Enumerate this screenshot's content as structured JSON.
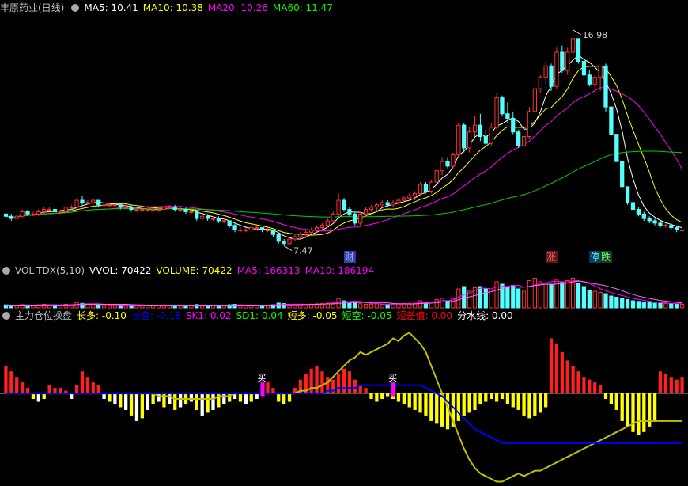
{
  "price_panel": {
    "title": "丰原药业(日线)",
    "ma_labels": [
      {
        "text": "MA5: 10.41",
        "color": "#ffffff"
      },
      {
        "text": "MA10: 10.38",
        "color": "#ffff00"
      },
      {
        "text": "MA20: 10.26",
        "color": "#ff00ff"
      },
      {
        "text": "MA60: 11.47",
        "color": "#00ff00"
      }
    ],
    "high_label": "16.98",
    "low_label": "7.47",
    "markers": [
      "财",
      "涨",
      "停",
      "跌"
    ]
  },
  "volume_panel": {
    "labels": [
      {
        "text": "VOL-TDX(5,10)",
        "color": "#c0c0c0"
      },
      {
        "text": "VVOL: 70422",
        "color": "#ffffff"
      },
      {
        "text": "VOLUME: 70422",
        "color": "#ffff00"
      },
      {
        "text": "MA5: 166313",
        "color": "#ff00ff"
      },
      {
        "text": "MA10: 186194",
        "color": "#ff00ff"
      }
    ]
  },
  "indicator_panel": {
    "labels": [
      {
        "text": "主力仓位操盘",
        "color": "#c0c0c0"
      },
      {
        "text": "长多: -0.10",
        "color": "#ffff00"
      },
      {
        "text": "长空: -0.18",
        "color": "#0000ff"
      },
      {
        "text": "SK1: 0.02",
        "color": "#ff00ff"
      },
      {
        "text": "SD1: 0.04",
        "color": "#00ff00"
      },
      {
        "text": "短多: -0.05",
        "color": "#ffff00"
      },
      {
        "text": "短空: -0.05",
        "color": "#00ff00"
      },
      {
        "text": "短差值: 0.00",
        "color": "#ff0000"
      },
      {
        "text": "分水线: 0.00",
        "color": "#ffffff"
      }
    ],
    "buy_label": "买"
  },
  "chart_data": {
    "type": "candlestick",
    "price_range": [
      7.0,
      17.6
    ],
    "candles": [
      [
        8.9,
        9.0,
        8.7,
        8.8
      ],
      [
        8.8,
        8.9,
        8.6,
        8.7
      ],
      [
        8.7,
        8.9,
        8.7,
        8.8
      ],
      [
        8.8,
        9.1,
        8.7,
        9.0
      ],
      [
        9.0,
        9.1,
        8.8,
        8.9
      ],
      [
        8.9,
        9.0,
        8.8,
        8.9
      ],
      [
        8.9,
        9.1,
        8.8,
        9.0
      ],
      [
        9.0,
        9.2,
        8.9,
        9.1
      ],
      [
        9.1,
        9.2,
        9.0,
        9.1
      ],
      [
        9.1,
        9.2,
        8.9,
        9.0
      ],
      [
        9.0,
        9.1,
        8.9,
        9.0
      ],
      [
        9.0,
        9.3,
        9.0,
        9.2
      ],
      [
        9.2,
        9.3,
        9.1,
        9.2
      ],
      [
        9.2,
        9.6,
        9.1,
        9.5
      ],
      [
        9.5,
        9.7,
        9.3,
        9.4
      ],
      [
        9.4,
        9.5,
        9.3,
        9.4
      ],
      [
        9.4,
        9.6,
        9.3,
        9.5
      ],
      [
        9.5,
        9.5,
        9.2,
        9.3
      ],
      [
        9.3,
        9.4,
        9.2,
        9.3
      ],
      [
        9.3,
        9.4,
        9.2,
        9.3
      ],
      [
        9.3,
        9.4,
        9.2,
        9.3
      ],
      [
        9.3,
        9.4,
        9.1,
        9.2
      ],
      [
        9.2,
        9.3,
        9.1,
        9.2
      ],
      [
        9.2,
        9.3,
        9.0,
        9.1
      ],
      [
        9.1,
        9.2,
        9.0,
        9.1
      ],
      [
        9.1,
        9.2,
        9.0,
        9.1
      ],
      [
        9.1,
        9.2,
        9.0,
        9.1
      ],
      [
        9.1,
        9.2,
        9.0,
        9.1
      ],
      [
        9.1,
        9.2,
        9.0,
        9.1
      ],
      [
        9.1,
        9.3,
        9.0,
        9.2
      ],
      [
        9.2,
        9.3,
        9.1,
        9.2
      ],
      [
        9.2,
        9.3,
        9.0,
        9.1
      ],
      [
        9.1,
        9.2,
        9.0,
        9.1
      ],
      [
        9.1,
        9.2,
        8.9,
        9.0
      ],
      [
        9.0,
        9.1,
        8.9,
        9.0
      ],
      [
        9.0,
        9.0,
        8.6,
        8.7
      ],
      [
        8.7,
        8.9,
        8.6,
        8.8
      ],
      [
        8.8,
        8.9,
        8.6,
        8.7
      ],
      [
        8.7,
        8.8,
        8.6,
        8.7
      ],
      [
        8.7,
        8.8,
        8.5,
        8.6
      ],
      [
        8.6,
        8.7,
        8.5,
        8.6
      ],
      [
        8.6,
        8.6,
        8.3,
        8.4
      ],
      [
        8.4,
        8.5,
        8.1,
        8.2
      ],
      [
        8.2,
        8.3,
        8.1,
        8.2
      ],
      [
        8.2,
        8.3,
        8.1,
        8.2
      ],
      [
        8.2,
        8.4,
        8.1,
        8.3
      ],
      [
        8.3,
        8.4,
        8.2,
        8.3
      ],
      [
        8.3,
        8.3,
        8.1,
        8.2
      ],
      [
        8.2,
        8.3,
        8.1,
        8.2
      ],
      [
        8.2,
        8.2,
        7.9,
        8.0
      ],
      [
        8.0,
        8.1,
        7.6,
        7.7
      ],
      [
        7.7,
        7.8,
        7.5,
        7.6
      ],
      [
        7.6,
        7.9,
        7.5,
        7.8
      ],
      [
        7.8,
        8.0,
        7.7,
        7.9
      ],
      [
        7.9,
        8.1,
        7.8,
        8.0
      ],
      [
        8.0,
        8.2,
        7.9,
        8.1
      ],
      [
        8.1,
        8.3,
        8.0,
        8.2
      ],
      [
        8.2,
        8.4,
        8.1,
        8.3
      ],
      [
        8.3,
        8.5,
        8.2,
        8.4
      ],
      [
        8.4,
        8.7,
        8.3,
        8.6
      ],
      [
        8.6,
        9.0,
        8.5,
        8.9
      ],
      [
        8.9,
        9.8,
        8.8,
        9.5
      ],
      [
        9.5,
        9.6,
        9.0,
        9.1
      ],
      [
        9.1,
        9.2,
        8.8,
        8.9
      ],
      [
        8.9,
        9.0,
        8.4,
        8.5
      ],
      [
        8.5,
        9.0,
        8.4,
        8.9
      ],
      [
        8.9,
        9.2,
        8.8,
        9.1
      ],
      [
        9.1,
        9.3,
        9.0,
        9.2
      ],
      [
        9.2,
        9.4,
        9.0,
        9.3
      ],
      [
        9.3,
        9.5,
        9.2,
        9.4
      ],
      [
        9.4,
        9.5,
        9.2,
        9.3
      ],
      [
        9.3,
        9.5,
        9.2,
        9.4
      ],
      [
        9.4,
        9.6,
        9.3,
        9.5
      ],
      [
        9.5,
        9.7,
        9.4,
        9.6
      ],
      [
        9.6,
        9.8,
        9.5,
        9.7
      ],
      [
        9.7,
        9.9,
        9.5,
        9.8
      ],
      [
        9.8,
        10.3,
        9.7,
        10.2
      ],
      [
        10.2,
        10.3,
        9.8,
        9.9
      ],
      [
        9.9,
        10.4,
        9.8,
        10.3
      ],
      [
        10.3,
        10.9,
        10.2,
        10.8
      ],
      [
        10.8,
        11.4,
        10.6,
        11.2
      ],
      [
        11.2,
        11.4,
        10.9,
        11.0
      ],
      [
        11.0,
        11.6,
        10.9,
        11.5
      ],
      [
        11.5,
        12.9,
        11.4,
        12.8
      ],
      [
        12.8,
        12.9,
        11.6,
        11.8
      ],
      [
        11.8,
        12.7,
        11.6,
        12.5
      ],
      [
        12.5,
        13.2,
        12.3,
        12.8
      ],
      [
        12.8,
        13.3,
        12.1,
        12.3
      ],
      [
        12.3,
        12.6,
        11.8,
        12.0
      ],
      [
        12.0,
        12.9,
        11.9,
        12.7
      ],
      [
        12.7,
        14.2,
        12.6,
        14.0
      ],
      [
        14.0,
        14.1,
        13.2,
        13.3
      ],
      [
        13.3,
        13.8,
        12.9,
        13.1
      ],
      [
        13.1,
        13.4,
        12.4,
        12.5
      ],
      [
        12.5,
        12.6,
        11.8,
        11.9
      ],
      [
        11.9,
        12.4,
        11.8,
        12.3
      ],
      [
        12.3,
        13.6,
        12.2,
        13.4
      ],
      [
        13.4,
        14.5,
        13.3,
        14.4
      ],
      [
        14.4,
        15.0,
        14.2,
        14.9
      ],
      [
        14.9,
        15.6,
        14.6,
        15.4
      ],
      [
        15.4,
        15.5,
        14.3,
        14.5
      ],
      [
        14.5,
        16.2,
        14.4,
        16.0
      ],
      [
        16.0,
        16.3,
        15.1,
        15.2
      ],
      [
        15.2,
        16.2,
        15.0,
        16.0
      ],
      [
        16.0,
        16.98,
        15.8,
        16.6
      ],
      [
        16.6,
        16.6,
        15.5,
        15.6
      ],
      [
        15.6,
        15.8,
        14.8,
        15.0
      ],
      [
        15.0,
        15.2,
        14.5,
        14.6
      ],
      [
        14.6,
        15.0,
        14.2,
        14.9
      ],
      [
        14.9,
        15.4,
        14.3,
        15.4
      ],
      [
        15.4,
        15.5,
        13.4,
        13.6
      ],
      [
        13.6,
        13.6,
        12.4,
        12.4
      ],
      [
        12.4,
        12.4,
        11.2,
        11.2
      ],
      [
        11.2,
        11.2,
        10.1,
        10.1
      ],
      [
        10.1,
        10.1,
        9.3,
        9.4
      ],
      [
        9.4,
        9.5,
        9.0,
        9.1
      ],
      [
        9.1,
        9.2,
        8.8,
        8.9
      ],
      [
        8.9,
        9.0,
        8.6,
        8.7
      ],
      [
        8.7,
        8.8,
        8.5,
        8.6
      ],
      [
        8.6,
        8.7,
        8.4,
        8.5
      ],
      [
        8.5,
        8.6,
        8.3,
        8.4
      ],
      [
        8.4,
        8.5,
        8.3,
        8.4
      ],
      [
        8.4,
        8.5,
        8.2,
        8.3
      ],
      [
        8.3,
        8.4,
        8.1,
        8.2
      ],
      [
        8.2,
        8.3,
        8.1,
        8.2
      ]
    ],
    "volumes": [
      25,
      22,
      20,
      28,
      24,
      22,
      26,
      30,
      25,
      24,
      22,
      30,
      26,
      45,
      38,
      30,
      34,
      28,
      26,
      24,
      25,
      24,
      22,
      24,
      22,
      20,
      22,
      21,
      22,
      24,
      22,
      24,
      22,
      21,
      22,
      28,
      24,
      22,
      20,
      21,
      22,
      26,
      30,
      24,
      20,
      22,
      20,
      22,
      20,
      26,
      40,
      36,
      30,
      26,
      28,
      30,
      32,
      34,
      36,
      40,
      45,
      80,
      60,
      40,
      55,
      35,
      30,
      32,
      34,
      30,
      28,
      32,
      34,
      36,
      38,
      40,
      60,
      50,
      48,
      70,
      80,
      60,
      80,
      160,
      180,
      140,
      170,
      180,
      160,
      150,
      220,
      200,
      180,
      190,
      160,
      140,
      230,
      250,
      220,
      210,
      200,
      240,
      220,
      230,
      250,
      210,
      180,
      150,
      140,
      130,
      120,
      100,
      90,
      80,
      70,
      60,
      55,
      50,
      45,
      40,
      38,
      36,
      34,
      32,
      30
    ],
    "volume_max": 260,
    "indicator_range": [
      -0.33,
      0.25
    ],
    "indicator_bars": [
      0.1,
      0.08,
      0.06,
      0.04,
      0.02,
      -0.02,
      -0.03,
      -0.02,
      0.03,
      0.02,
      0.02,
      0.01,
      -0.02,
      0.03,
      0.08,
      0.06,
      0.04,
      0.03,
      -0.02,
      -0.03,
      -0.04,
      -0.05,
      -0.06,
      -0.08,
      -0.1,
      -0.09,
      -0.06,
      -0.04,
      -0.03,
      -0.05,
      -0.04,
      -0.06,
      -0.05,
      -0.04,
      -0.03,
      -0.06,
      -0.08,
      -0.07,
      -0.06,
      -0.05,
      -0.04,
      -0.03,
      -0.02,
      -0.03,
      -0.04,
      -0.03,
      -0.02,
      0.03,
      0.04,
      0.02,
      -0.03,
      -0.04,
      -0.03,
      0.02,
      0.05,
      0.07,
      0.09,
      0.1,
      0.08,
      0.06,
      0.05,
      0.07,
      0.09,
      0.08,
      0.05,
      0.03,
      0.02,
      -0.02,
      -0.03,
      -0.02,
      -0.01,
      -0.02,
      -0.03,
      -0.04,
      -0.05,
      -0.06,
      -0.07,
      -0.08,
      -0.1,
      -0.11,
      -0.12,
      -0.13,
      -0.12,
      -0.1,
      -0.08,
      -0.07,
      -0.06,
      -0.04,
      -0.03,
      -0.02,
      -0.03,
      -0.02,
      -0.04,
      -0.05,
      -0.06,
      -0.08,
      -0.09,
      -0.08,
      -0.07,
      -0.05,
      0.2,
      0.18,
      0.15,
      0.12,
      0.1,
      0.08,
      0.06,
      0.05,
      0.04,
      0.03,
      -0.02,
      -0.04,
      -0.06,
      -0.1,
      -0.12,
      -0.14,
      -0.15,
      -0.14,
      -0.12,
      -0.1,
      0.08,
      0.07,
      0.06,
      0.05,
      0.06
    ],
    "indicator_lines": [
      {
        "name": "长多",
        "color": "#c0c000",
        "values": [
          0.0,
          0.0,
          0.0,
          0.0,
          0.0,
          0.0,
          0.0,
          0.0,
          0.0,
          0.0,
          0.0,
          0.0,
          0.0,
          0.0,
          0.0,
          0.0,
          0.0,
          0.0,
          0.0,
          0.0,
          0.0,
          0.0,
          0.0,
          0.0,
          0.0,
          0.0,
          0.0,
          0.0,
          -0.01,
          -0.01,
          -0.01,
          -0.02,
          -0.02,
          -0.02,
          -0.02,
          -0.02,
          -0.02,
          -0.02,
          -0.02,
          -0.01,
          -0.01,
          -0.01,
          0.0,
          0.0,
          0.0,
          0.0,
          0.0,
          0.0,
          0.0,
          0.0,
          0.0,
          0.0,
          0.0,
          0.0,
          0.01,
          0.01,
          0.02,
          0.02,
          0.03,
          0.04,
          0.06,
          0.08,
          0.1,
          0.12,
          0.13,
          0.15,
          0.14,
          0.15,
          0.16,
          0.17,
          0.18,
          0.2,
          0.19,
          0.21,
          0.22,
          0.2,
          0.18,
          0.15,
          0.1,
          0.05,
          0.0,
          -0.05,
          -0.1,
          -0.15,
          -0.2,
          -0.24,
          -0.27,
          -0.29,
          -0.3,
          -0.31,
          -0.32,
          -0.32,
          -0.31,
          -0.3,
          -0.29,
          -0.3,
          -0.29,
          -0.28,
          -0.28,
          -0.27,
          -0.26,
          -0.25,
          -0.24,
          -0.23,
          -0.22,
          -0.21,
          -0.2,
          -0.19,
          -0.18,
          -0.17,
          -0.16,
          -0.15,
          -0.14,
          -0.13,
          -0.12,
          -0.11,
          -0.1,
          -0.1,
          -0.1,
          -0.1,
          -0.1,
          -0.1,
          -0.1,
          -0.1,
          -0.1
        ]
      },
      {
        "name": "长空",
        "color": "#0000ff",
        "values": [
          0.0,
          0.0,
          0.0,
          0.0,
          0.0,
          0.0,
          0.0,
          0.0,
          0.0,
          0.0,
          0.0,
          0.0,
          0.0,
          0.0,
          0.0,
          0.0,
          0.0,
          0.0,
          0.0,
          0.0,
          0.0,
          0.0,
          0.0,
          0.0,
          0.0,
          0.0,
          0.0,
          0.0,
          0.0,
          0.0,
          0.0,
          0.0,
          0.0,
          0.0,
          0.0,
          0.0,
          0.0,
          0.0,
          0.0,
          0.0,
          0.0,
          0.0,
          0.0,
          0.0,
          0.0,
          0.0,
          0.0,
          0.0,
          0.0,
          0.0,
          0.0,
          0.0,
          0.0,
          0.0,
          0.0,
          0.0,
          0.0,
          0.0,
          0.0,
          0.01,
          0.01,
          0.02,
          0.02,
          0.02,
          0.02,
          0.03,
          0.03,
          0.03,
          0.03,
          0.03,
          0.03,
          0.03,
          0.03,
          0.03,
          0.03,
          0.03,
          0.03,
          0.02,
          0.01,
          0.0,
          -0.01,
          -0.03,
          -0.05,
          -0.07,
          -0.09,
          -0.11,
          -0.13,
          -0.14,
          -0.15,
          -0.16,
          -0.17,
          -0.18,
          -0.18,
          -0.18,
          -0.18,
          -0.18,
          -0.18,
          -0.18,
          -0.18,
          -0.18,
          -0.18,
          -0.18,
          -0.18,
          -0.18,
          -0.18,
          -0.18,
          -0.18,
          -0.18,
          -0.18,
          -0.18,
          -0.18,
          -0.18,
          -0.18,
          -0.18,
          -0.18,
          -0.18,
          -0.18,
          -0.18,
          -0.18,
          -0.18,
          -0.18,
          -0.18,
          -0.18,
          -0.18,
          -0.18
        ]
      }
    ],
    "buy_signals": [
      47,
      71
    ]
  }
}
